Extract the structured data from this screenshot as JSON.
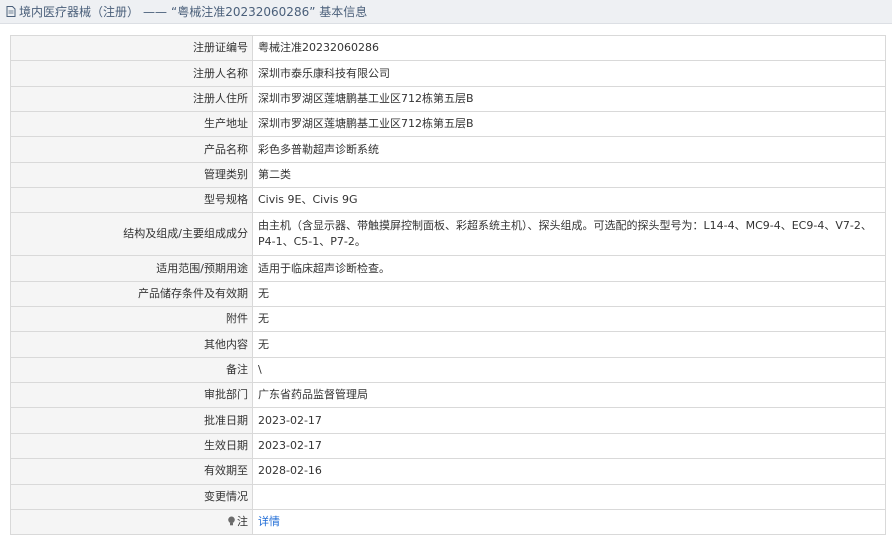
{
  "header": {
    "category": "境内医疗器械（注册）",
    "dash": "——",
    "title": "“粤械注准20232060286”  基本信息"
  },
  "rows": [
    {
      "label": "注册证编号",
      "value": "粤械注准20232060286"
    },
    {
      "label": "注册人名称",
      "value": "深圳市泰乐康科技有限公司"
    },
    {
      "label": "注册人住所",
      "value": "深圳市罗湖区莲塘鹏基工业区712栋第五层B"
    },
    {
      "label": "生产地址",
      "value": "深圳市罗湖区莲塘鹏基工业区712栋第五层B"
    },
    {
      "label": "产品名称",
      "value": "彩色多普勒超声诊断系统"
    },
    {
      "label": "管理类别",
      "value": "第二类"
    },
    {
      "label": "型号规格",
      "value": "Civis 9E、Civis 9G"
    },
    {
      "label": "结构及组成/主要组成成分",
      "value": "由主机（含显示器、带触摸屏控制面板、彩超系统主机）、探头组成。可选配的探头型号为：L14-4、MC9-4、EC9-4、V7-2、P4-1、C5-1、P7-2。"
    },
    {
      "label": "适用范围/预期用途",
      "value": "适用于临床超声诊断检查。"
    },
    {
      "label": "产品储存条件及有效期",
      "value": "无"
    },
    {
      "label": "附件",
      "value": "无"
    },
    {
      "label": "其他内容",
      "value": "无"
    },
    {
      "label": "备注",
      "value": "\\"
    },
    {
      "label": "审批部门",
      "value": "广东省药品监督管理局"
    },
    {
      "label": "批准日期",
      "value": "2023-02-17"
    },
    {
      "label": "生效日期",
      "value": "2023-02-17"
    },
    {
      "label": "有效期至",
      "value": "2028-02-16"
    },
    {
      "label": "变更情况",
      "value": ""
    }
  ],
  "note": {
    "label": "注",
    "link": "详情"
  },
  "icons": {
    "title": "document-icon",
    "note": "lightbulb-icon"
  },
  "colors": {
    "link": "#1e6bd6",
    "label_bg": "#f5f5f5",
    "border": "#d9d9d9",
    "header_text": "#4a5f7a"
  }
}
